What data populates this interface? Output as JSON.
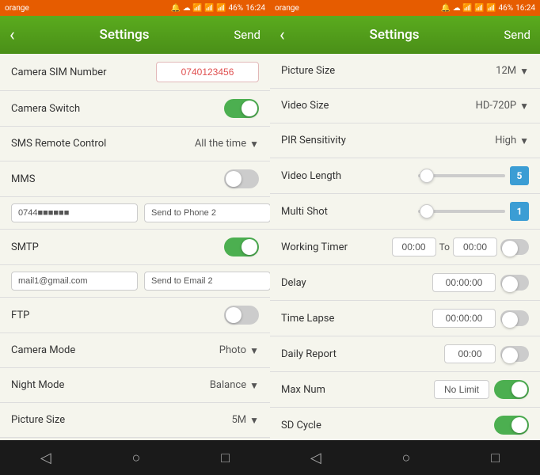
{
  "panels": {
    "left": {
      "status": {
        "carrier": "orange",
        "icons": "📶",
        "battery": "46%",
        "time": "16:24"
      },
      "header": {
        "back_label": "‹",
        "title": "Settings",
        "send_label": "Send"
      },
      "rows": [
        {
          "id": "camera-sim",
          "label": "Camera SIM Number",
          "type": "input-red",
          "value": "0740123456"
        },
        {
          "id": "camera-switch",
          "label": "Camera Switch",
          "type": "toggle",
          "value": "on"
        },
        {
          "id": "sms-remote",
          "label": "SMS Remote Control",
          "type": "dropdown",
          "value": "All the time"
        },
        {
          "id": "mms",
          "label": "MMS",
          "type": "toggle",
          "value": "off"
        }
      ],
      "phone_row": {
        "input_value": "0744■■■■■■",
        "send_label": "Send to Phone 2"
      },
      "smtp_row": {
        "label": "SMTP",
        "toggle": "on"
      },
      "email_row": {
        "input_value": "mail1@gmail.com",
        "send_label": "Send to Email 2"
      },
      "ftp_row": {
        "label": "FTP",
        "toggle": "off"
      },
      "bottom_rows": [
        {
          "id": "camera-mode",
          "label": "Camera Mode",
          "type": "dropdown",
          "value": "Photo"
        },
        {
          "id": "night-mode",
          "label": "Night Mode",
          "type": "dropdown",
          "value": "Balance"
        },
        {
          "id": "picture-size",
          "label": "Picture Size",
          "type": "dropdown",
          "value": "5M"
        }
      ]
    },
    "right": {
      "status": {
        "carrier": "orange",
        "battery": "46%",
        "time": "16:24"
      },
      "header": {
        "back_label": "‹",
        "title": "Settings",
        "send_label": "Send"
      },
      "rows": [
        {
          "id": "picture-size",
          "label": "Picture Size",
          "type": "dropdown",
          "value": "12M"
        },
        {
          "id": "video-size",
          "label": "Video Size",
          "type": "dropdown",
          "value": "HD-720P"
        },
        {
          "id": "pir-sensitivity",
          "label": "PIR Sensitivity",
          "type": "dropdown",
          "value": "High"
        },
        {
          "id": "video-length",
          "label": "Video Length",
          "type": "slider",
          "value": "5"
        },
        {
          "id": "multi-shot",
          "label": "Multi Shot",
          "type": "slider",
          "value": "1"
        },
        {
          "id": "working-timer",
          "label": "Working Timer",
          "type": "timer-range",
          "from": "00:00",
          "to": "00:00"
        },
        {
          "id": "delay",
          "label": "Delay",
          "type": "time-input",
          "value": "00:00:00"
        },
        {
          "id": "time-lapse",
          "label": "Time Lapse",
          "type": "time-input",
          "value": "00:00:00"
        },
        {
          "id": "daily-report",
          "label": "Daily Report",
          "type": "time-input-short",
          "value": "00:00"
        },
        {
          "id": "max-num",
          "label": "Max Num",
          "type": "text-toggle",
          "text_value": "No Limit",
          "toggle": "on"
        },
        {
          "id": "sd-cycle",
          "label": "SD Cycle",
          "type": "toggle-only",
          "toggle": "on"
        }
      ]
    }
  },
  "nav": {
    "back_icon": "◁",
    "home_icon": "○",
    "recent_icon": "□"
  }
}
